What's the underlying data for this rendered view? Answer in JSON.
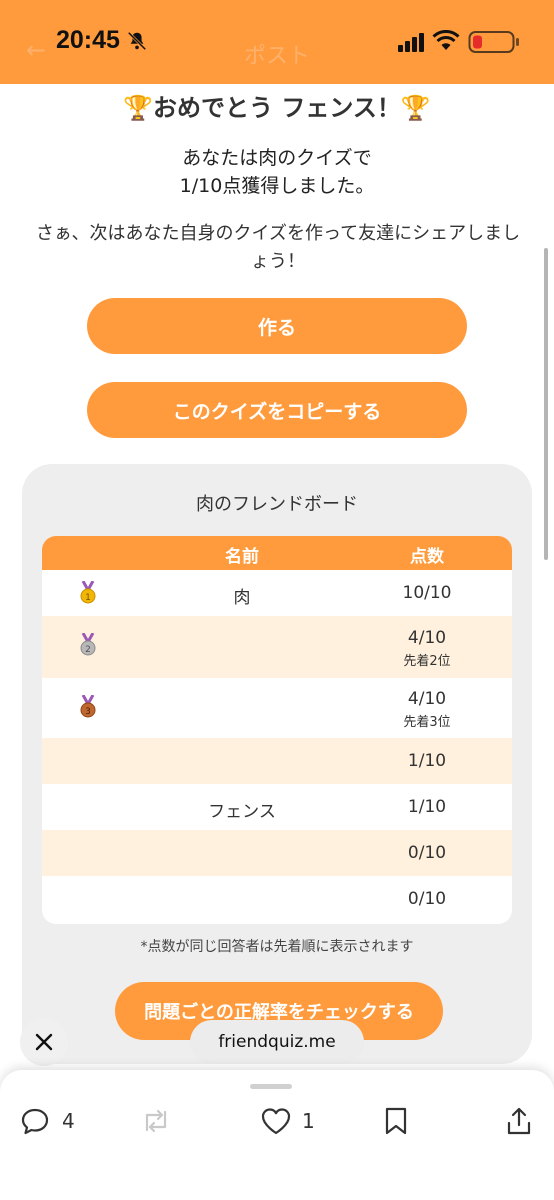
{
  "status_bar": {
    "time": "20:45",
    "header_title": "ポスト",
    "icons": [
      "bell-slash-icon",
      "signal-icon",
      "wifi-icon",
      "battery-low-icon"
    ]
  },
  "result": {
    "congrats": "🏆おめでとう フェンス！🏆",
    "score_message": "あなたは肉のクイズで\n1/10点獲得しました。",
    "invite": "さぁ、次はあなた自身のクイズを作って友達にシェアしましょう！"
  },
  "buttons": {
    "make": "作る",
    "copy": "このクイズをコピーする",
    "check": "問題ごとの正解率をチェックする"
  },
  "board": {
    "title": "肉のフレンドボード",
    "columns": {
      "name": "名前",
      "score": "点数"
    },
    "rows": [
      {
        "medal": "gold-medal-icon",
        "name": "肉",
        "score": "10/10",
        "note": ""
      },
      {
        "medal": "silver-medal-icon",
        "name": "",
        "score": "4/10",
        "note": "先着2位"
      },
      {
        "medal": "bronze-medal-icon",
        "name": "",
        "score": "4/10",
        "note": "先着3位"
      },
      {
        "medal": "",
        "name": "",
        "score": "1/10",
        "note": ""
      },
      {
        "medal": "",
        "name": "フェンス",
        "score": "1/10",
        "note": ""
      },
      {
        "medal": "",
        "name": "",
        "score": "0/10",
        "note": ""
      },
      {
        "medal": "",
        "name": "",
        "score": "0/10",
        "note": ""
      }
    ],
    "footnote": "*点数が同じ回答者は先着順に表示されます"
  },
  "overlay": {
    "domain": "friendquiz.me",
    "close_icon": "close-icon"
  },
  "actions": {
    "reply_count": "4",
    "repost_count": "",
    "like_count": "1"
  },
  "colors": {
    "accent": "#ff9b3d",
    "row_alt": "#fff1dd",
    "board_bg": "#eeeeee"
  }
}
